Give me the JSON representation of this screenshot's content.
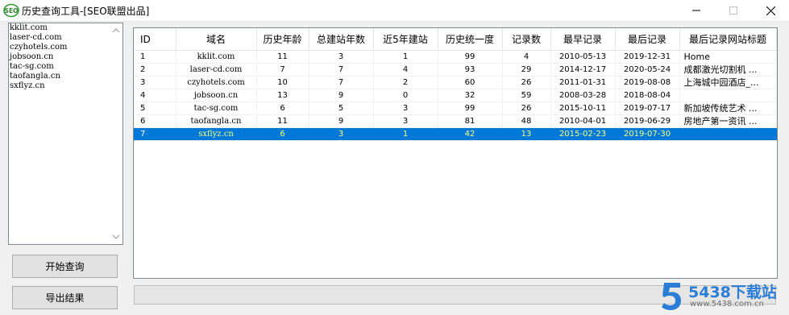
{
  "window": {
    "title": "历史查询工具-[SEO联盟出品]",
    "icon": "seo-app-icon",
    "controls": [
      "minimize-icon",
      "maximize-icon",
      "close-icon"
    ]
  },
  "domain_list": [
    "kklit.com",
    "laser-cd.com",
    "czyhotels.com",
    "jobsoon.cn",
    "tac-sg.com",
    "taofangla.cn",
    "sxflyz.cn"
  ],
  "buttons": {
    "query": "开始查询",
    "export": "导出结果"
  },
  "table": {
    "columns": [
      "ID",
      "域名",
      "历史年龄",
      "总建站年数",
      "近5年建站",
      "历史统一度",
      "记录数",
      "最早记录",
      "最后记录",
      "最后记录网站标题"
    ],
    "rows": [
      [
        "1",
        "kklit.com",
        "11",
        "3",
        "1",
        "99",
        "4",
        "2010-05-13",
        "2019-12-31",
        "Home"
      ],
      [
        "2",
        "laser-cd.com",
        "7",
        "7",
        "4",
        "93",
        "29",
        "2014-12-17",
        "2020-05-24",
        "成都激光切割机 ..."
      ],
      [
        "3",
        "czyhotels.com",
        "10",
        "7",
        "2",
        "60",
        "26",
        "2011-01-31",
        "2019-08-08",
        "上海城中园酒店_..."
      ],
      [
        "4",
        "jobsoon.cn",
        "13",
        "9",
        "0",
        "32",
        "59",
        "2008-03-28",
        "2018-08-04",
        ""
      ],
      [
        "5",
        "tac-sg.com",
        "6",
        "5",
        "3",
        "99",
        "26",
        "2015-10-11",
        "2019-07-17",
        "新加坡传统艺术 ..."
      ],
      [
        "6",
        "taofangla.cn",
        "11",
        "9",
        "3",
        "81",
        "48",
        "2010-04-01",
        "2019-06-29",
        "房地产第一资讯 ..."
      ],
      [
        "7",
        "sxflyz.cn",
        "6",
        "3",
        "1",
        "42",
        "13",
        "2015-02-23",
        "2019-07-30",
        ""
      ]
    ],
    "selected_row": 6
  },
  "progress": {
    "value": 0
  },
  "watermark": {
    "text": "5438下载站",
    "url": "www.5438.com.cn"
  },
  "colors": {
    "selection": "#0078d7",
    "selection_text": "#f4ff80",
    "watermark": "#2b7dd6"
  }
}
